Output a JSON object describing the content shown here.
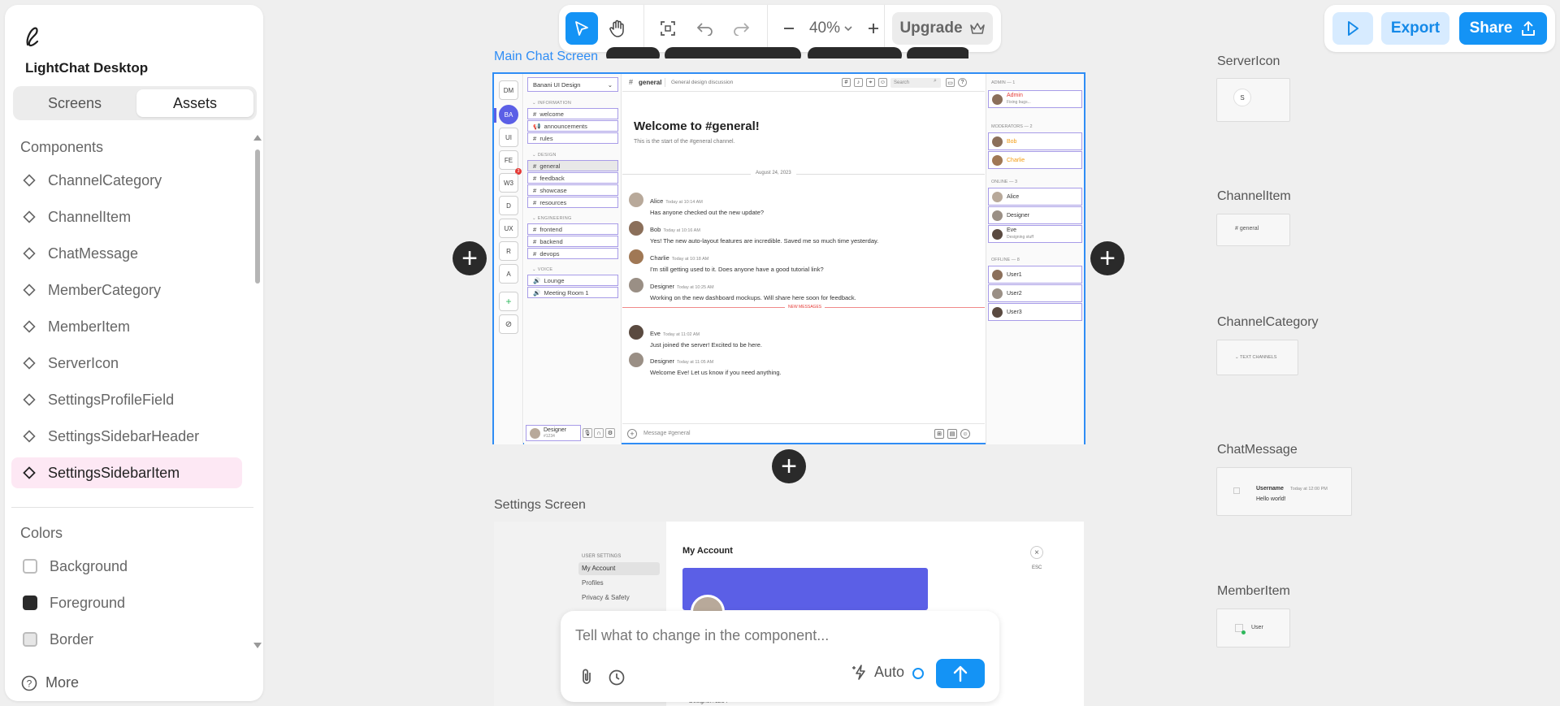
{
  "app": {
    "name": "LightChat Desktop"
  },
  "left_panel": {
    "tabs": {
      "screens": "Screens",
      "assets": "Assets"
    },
    "components_header": "Components",
    "components": [
      "ChannelCategory",
      "ChannelItem",
      "ChatMessage",
      "MemberCategory",
      "MemberItem",
      "ServerIcon",
      "SettingsProfileField",
      "SettingsSidebarHeader",
      "SettingsSidebarItem"
    ],
    "active_component": "SettingsSidebarItem",
    "colors_header": "Colors",
    "colors": [
      {
        "name": "Background",
        "hex": "#ffffff"
      },
      {
        "name": "Foreground",
        "hex": "#2a2a2a"
      },
      {
        "name": "Border",
        "hex": "#e6e6e6"
      }
    ],
    "more_label": "More"
  },
  "toolbar": {
    "zoom": "40%",
    "upgrade_label": "Upgrade",
    "export_label": "Export",
    "share_label": "Share"
  },
  "frames": {
    "main_label": "Main Chat Screen",
    "settings_label": "Settings Screen"
  },
  "main_screen": {
    "servers": [
      "DM",
      "BA",
      "UI",
      "FE",
      "W3",
      "D",
      "UX",
      "R",
      "A"
    ],
    "server_badge": "3",
    "server_name": "Banani UI Design",
    "categories": [
      {
        "name": "INFORMATION",
        "channels": [
          "welcome",
          "announcements",
          "rules"
        ]
      },
      {
        "name": "DESIGN",
        "channels": [
          "general",
          "feedback",
          "showcase",
          "resources"
        ]
      },
      {
        "name": "ENGINEERING",
        "channels": [
          "frontend",
          "backend",
          "devops"
        ]
      },
      {
        "name": "VOICE",
        "channels": [
          "Lounge",
          "Meeting Room 1"
        ]
      }
    ],
    "user": {
      "name": "Designer",
      "tag": "#1234"
    },
    "channel_title": "general",
    "channel_topic": "General design discussion",
    "search_placeholder": "Search",
    "welcome_title": "Welcome to #general!",
    "welcome_sub": "This is the start of the #general channel.",
    "date_divider": "August 24, 2023",
    "new_messages": "NEW MESSAGES",
    "messages": [
      {
        "user": "Alice",
        "time": "Today at 10:14 AM",
        "text": "Has anyone checked out the new update?"
      },
      {
        "user": "Bob",
        "time": "Today at 10:16 AM",
        "text": "Yes! The new auto-layout features are incredible. Saved me so much time yesterday."
      },
      {
        "user": "Charlie",
        "time": "Today at 10:18 AM",
        "text": "I'm still getting used to it. Does anyone have a good tutorial link?"
      },
      {
        "user": "Designer",
        "time": "Today at 10:25 AM",
        "text": "Working on the new dashboard mockups. Will share here soon for feedback."
      },
      {
        "user": "Eve",
        "time": "Today at 11:02 AM",
        "text": "Just joined the server! Excited to be here."
      },
      {
        "user": "Designer",
        "time": "Today at 11:05 AM",
        "text": "Welcome Eve! Let us know if you need anything."
      }
    ],
    "message_placeholder": "Message #general",
    "member_groups": [
      {
        "name": "ADMIN — 1",
        "members": [
          {
            "name": "Admin",
            "status": "Fixing bugs...",
            "color": "#e53935"
          }
        ]
      },
      {
        "name": "MODERATORS — 2",
        "members": [
          {
            "name": "Bob",
            "status": "",
            "color": "#f39c12"
          },
          {
            "name": "Charlie",
            "status": "",
            "color": "#f39c12"
          }
        ]
      },
      {
        "name": "ONLINE — 3",
        "members": [
          {
            "name": "Alice",
            "status": "",
            "color": "#333333"
          },
          {
            "name": "Designer",
            "status": "",
            "color": "#333333"
          },
          {
            "name": "Eve",
            "status": "Designing stuff",
            "color": "#333333"
          }
        ]
      },
      {
        "name": "OFFLINE — 8",
        "members": [
          {
            "name": "User1",
            "status": "",
            "color": "#333333"
          },
          {
            "name": "User2",
            "status": "",
            "color": "#333333"
          },
          {
            "name": "User3",
            "status": "",
            "color": "#333333"
          }
        ]
      }
    ]
  },
  "settings_screen": {
    "section": "USER SETTINGS",
    "items": [
      "My Account",
      "Profiles",
      "Privacy & Safety"
    ],
    "title": "My Account",
    "esc": "ESC",
    "bottom_text": "Designer#1234"
  },
  "preview_cards": {
    "server_icon": {
      "label": "ServerIcon",
      "text": "S"
    },
    "channel_item": {
      "label": "ChannelItem",
      "text": "# general"
    },
    "channel_category": {
      "label": "ChannelCategory",
      "text": "⌄ TEXT CHANNELS"
    },
    "chat_message": {
      "label": "ChatMessage",
      "user": "Username",
      "time": "Today at 12:00 PM",
      "text": "Hello world!"
    },
    "member_item": {
      "label": "MemberItem",
      "text": "User"
    }
  },
  "prompt": {
    "placeholder": "Tell what to change in the component...",
    "mode": "Auto"
  },
  "colors": {
    "accent": "#1493f5",
    "selection": "#2f8df5",
    "highlight": "#fde8f4",
    "discord_blurple": "#5b5fe6"
  }
}
